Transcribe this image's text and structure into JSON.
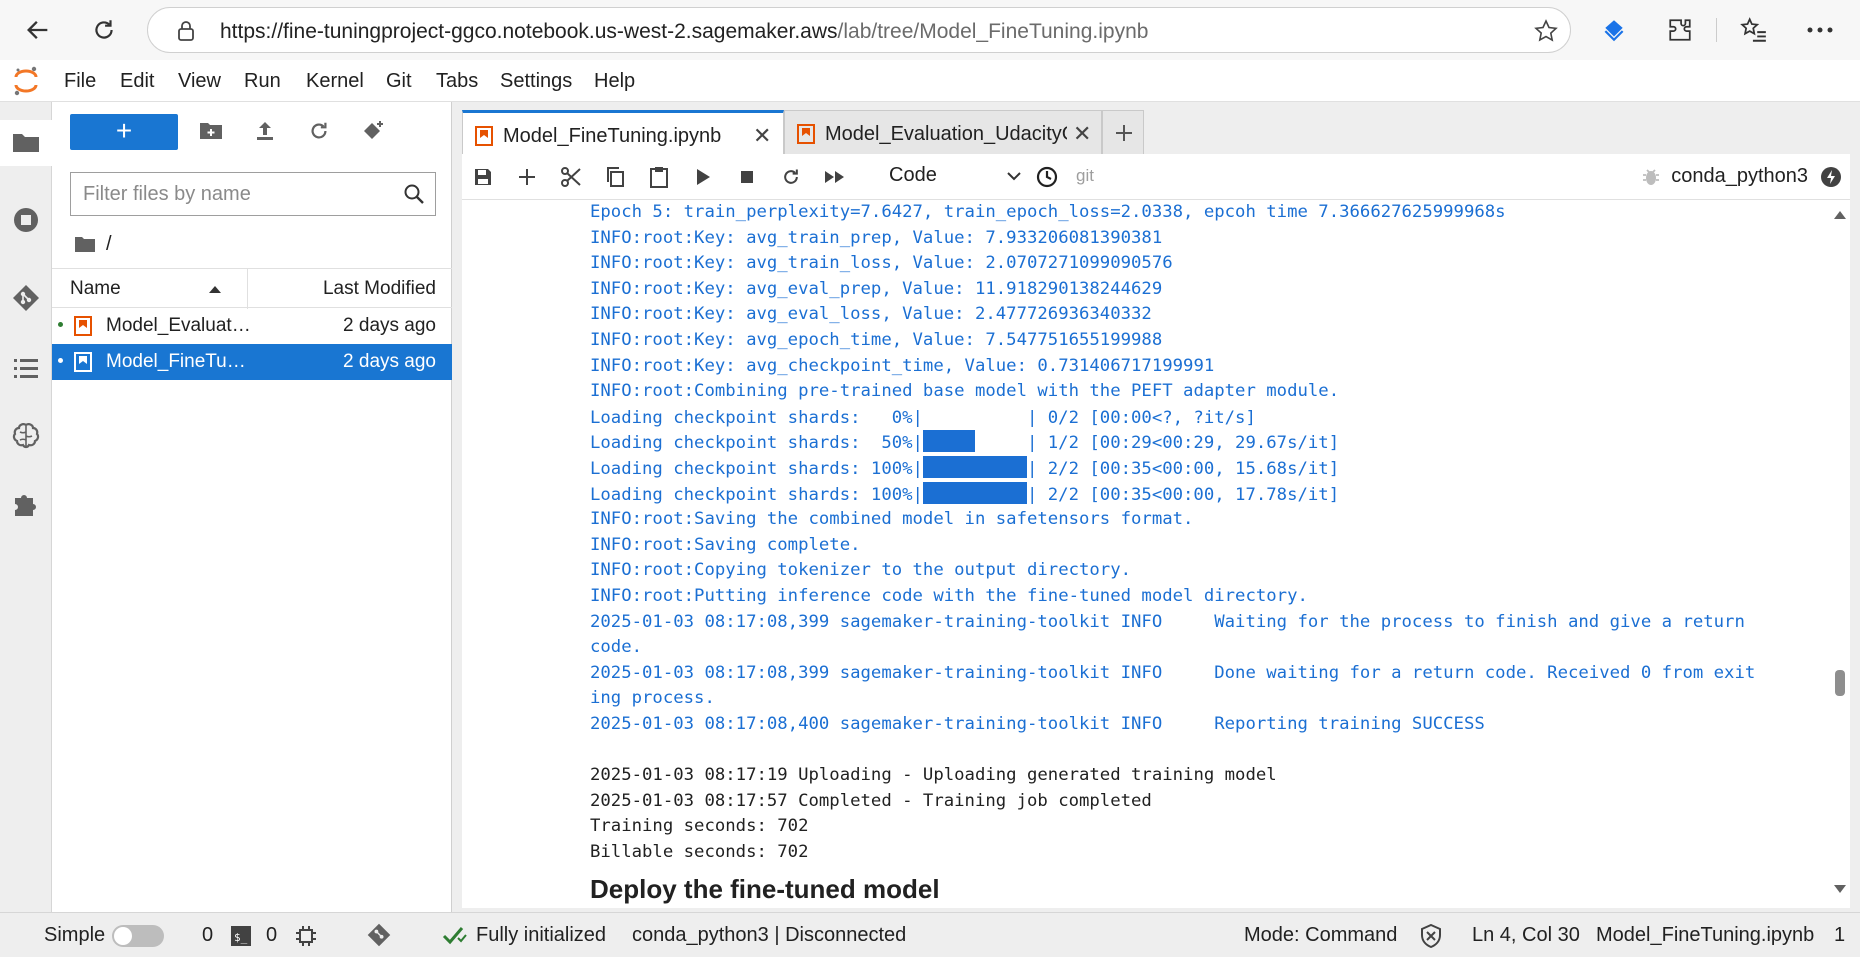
{
  "browser": {
    "url_main": "https://fine-tuningproject-ggco.notebook.us-west-2.sagemaker.aws",
    "url_path": "/lab/tree/Model_FineTuning.ipynb"
  },
  "menu": [
    "File",
    "Edit",
    "View",
    "Run",
    "Kernel",
    "Git",
    "Tabs",
    "Settings",
    "Help"
  ],
  "filebrowser": {
    "new_button": "+",
    "filter_placeholder": "Filter files by name",
    "breadcrumb": "/",
    "col_name": "Name",
    "col_modified": "Last Modified",
    "files": [
      {
        "name": "Model_Evaluation_UdacityGenAIAWS.ipynb",
        "modified": "2 days ago",
        "selected": false
      },
      {
        "name": "Model_FineTuning.ipynb",
        "modified": "2 days ago",
        "selected": true
      }
    ]
  },
  "tabs": [
    {
      "label": "Model_FineTuning.ipynb",
      "active": true
    },
    {
      "label": "Model_Evaluation_UdacityGe",
      "active": false
    }
  ],
  "toolbar": {
    "cell_type": "Code",
    "git": "git",
    "kernel": "conda_python3"
  },
  "output_lines": [
    {
      "text": "Epoch 5: train_perplexity=7.6427, train_epoch_loss=2.0338, epcoh time 7.366627625999968s",
      "color": "blue"
    },
    {
      "text": "INFO:root:Key: avg_train_prep, Value: 7.933206081390381",
      "color": "blue"
    },
    {
      "text": "INFO:root:Key: avg_train_loss, Value: 2.0707271099090576",
      "color": "blue"
    },
    {
      "text": "INFO:root:Key: avg_eval_prep, Value: 11.918290138244629",
      "color": "blue"
    },
    {
      "text": "INFO:root:Key: avg_eval_loss, Value: 2.477726936340332",
      "color": "blue"
    },
    {
      "text": "INFO:root:Key: avg_epoch_time, Value: 7.547751655199988",
      "color": "blue"
    },
    {
      "text": "INFO:root:Key: avg_checkpoint_time, Value: 0.731406717199991",
      "color": "blue"
    },
    {
      "text": "INFO:root:Combining pre-trained base model with the PEFT adapter module.",
      "color": "blue"
    },
    {
      "text": "Loading checkpoint shards:   0%|          | 0/2 [00:00<?, ?it/s]",
      "color": "blue",
      "bar": 0
    },
    {
      "text": "Loading checkpoint shards:  50%|          | 1/2 [00:29<00:29, 29.67s/it]",
      "color": "blue",
      "bar": 0.5
    },
    {
      "text": "Loading checkpoint shards: 100%|          | 2/2 [00:35<00:00, 15.68s/it]",
      "color": "blue",
      "bar": 1
    },
    {
      "text": "Loading checkpoint shards: 100%|          | 2/2 [00:35<00:00, 17.78s/it]",
      "color": "blue",
      "bar": 1
    },
    {
      "text": "INFO:root:Saving the combined model in safetensors format.",
      "color": "blue"
    },
    {
      "text": "INFO:root:Saving complete.",
      "color": "blue"
    },
    {
      "text": "INFO:root:Copying tokenizer to the output directory.",
      "color": "blue"
    },
    {
      "text": "INFO:root:Putting inference code with the fine-tuned model directory.",
      "color": "blue"
    },
    {
      "text": "2025-01-03 08:17:08,399 sagemaker-training-toolkit INFO     Waiting for the process to finish and give a return",
      "color": "blue"
    },
    {
      "text": "code.",
      "color": "blue"
    },
    {
      "text": "2025-01-03 08:17:08,399 sagemaker-training-toolkit INFO     Done waiting for a return code. Received 0 from exit",
      "color": "blue"
    },
    {
      "text": "ing process.",
      "color": "blue"
    },
    {
      "text": "2025-01-03 08:17:08,400 sagemaker-training-toolkit INFO     Reporting training SUCCESS",
      "color": "blue"
    },
    {
      "text": "",
      "color": "black"
    },
    {
      "text": "2025-01-03 08:17:19 Uploading - Uploading generated training model",
      "color": "black"
    },
    {
      "text": "2025-01-03 08:17:57 Completed - Training job completed",
      "color": "black"
    },
    {
      "text": "Training seconds: 702",
      "color": "black"
    },
    {
      "text": "Billable seconds: 702",
      "color": "black"
    }
  ],
  "markdown_heading": "Deploy the fine-tuned model",
  "status": {
    "mode_label": "Simple",
    "terminals": "0",
    "kernels": "0",
    "init": "Fully initialized",
    "kernel_status": "conda_python3 | Disconnected",
    "mode": "Mode: Command",
    "cursor": "Ln 4, Col 30",
    "file": "Model_FineTuning.ipynb",
    "badge": "1"
  },
  "colors": {
    "accent": "#1976d2",
    "output_blue": "#1b6fd3",
    "notebook_orange": "#e65100"
  }
}
